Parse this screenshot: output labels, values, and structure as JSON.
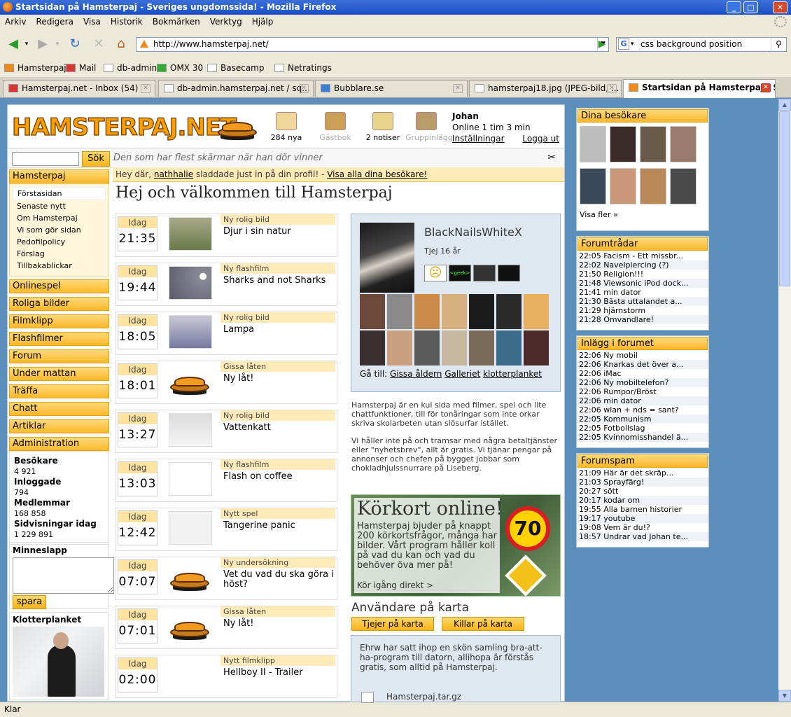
{
  "window": {
    "title": "Startsidan på Hamsterpaj - Sveriges ungdomssida! - Mozilla Firefox"
  },
  "menu": [
    "Arkiv",
    "Redigera",
    "Visa",
    "Historik",
    "Bokmärken",
    "Verktyg",
    "Hjälp"
  ],
  "nav": {
    "url": "http://www.hamsterpaj.net/",
    "search": "css background position"
  },
  "bookmarks": [
    {
      "label": "Hamsterpaj",
      "icon": "warning-triangle-icon"
    },
    {
      "label": "Mail",
      "icon": "gmail-icon"
    },
    {
      "label": "db-admin",
      "icon": "page-icon"
    },
    {
      "label": "OMX 30",
      "icon": "bar-chart-icon"
    },
    {
      "label": "Basecamp",
      "icon": "page-icon"
    },
    {
      "label": "Netratings",
      "icon": "page-icon"
    }
  ],
  "tabs": [
    {
      "label": "Hamsterpaj.net - Inbox (54)",
      "icon": "gmail-icon",
      "active": false
    },
    {
      "label": "db-admin.hamsterpaj.net / sq...",
      "icon": "page-icon",
      "active": false
    },
    {
      "label": "Bubblare.se",
      "icon": "bubble-icon",
      "active": false
    },
    {
      "label": "hamsterpaj18.jpg (JPEG-bild, ...",
      "icon": "page-icon",
      "active": false
    },
    {
      "label": "Startsidan på Hamsterpaj - S...",
      "icon": "warning-triangle-icon",
      "active": true
    }
  ],
  "status": "Klar",
  "site": {
    "logo": "HAMSTERPAJ.NET",
    "header_icons": [
      {
        "label": "284 nya",
        "icon": "envelope-icon",
        "dim": false
      },
      {
        "label": "Gästbok",
        "icon": "pencil-icon",
        "dim": true
      },
      {
        "label": "2 notiser",
        "icon": "note-icon",
        "dim": false
      },
      {
        "label": "Gruppinlägg",
        "icon": "group-icon",
        "dim": true
      }
    ],
    "user": {
      "name": "Johan",
      "online": "Online 1 tim 3 min",
      "settings": "Inställningar",
      "logout": "Logga ut"
    },
    "search": {
      "button": "Sök"
    },
    "slogan": "Den som har flest skärmar när han dör vinner",
    "notice": {
      "pre": "Hey där, ",
      "user": "nathhalie",
      "mid": " sladdade just in på din profil! - ",
      "link": "Visa alla dina besökare!"
    },
    "welcome": "Hej och välkommen till Hamsterpaj",
    "leftnav": {
      "main": "Hamsterpaj",
      "sub": [
        "Förstasidan",
        "Senaste nytt",
        "Om Hamsterpaj",
        "Vi som gör sidan",
        "Pedofilpolicy",
        "Förslag",
        "Tillbakablickar"
      ],
      "sections": [
        "Onlinespel",
        "Roliga bilder",
        "Filmklipp",
        "Flashfilmer",
        "Forum",
        "Under mattan",
        "Träffa",
        "Chatt",
        "Artiklar",
        "Administration"
      ]
    },
    "stats": [
      {
        "label": "Besökare",
        "value": "4 921"
      },
      {
        "label": "Inloggade",
        "value": "794"
      },
      {
        "label": "Medlemmar",
        "value": "168 858"
      },
      {
        "label": "Sidvisningar idag",
        "value": "1 229 891"
      }
    ],
    "memo": {
      "title": "Minneslapp",
      "button": "spara"
    },
    "klotter": {
      "title": "Klotterplanket"
    },
    "feed": [
      {
        "day": "Idag",
        "time": "21:35",
        "kind": "Ny rolig bild",
        "title": "Djur i sin natur",
        "thumb": "photo"
      },
      {
        "day": "Idag",
        "time": "19:44",
        "kind": "Ny flashfilm",
        "title": "Sharks and not Sharks",
        "thumb": "dark"
      },
      {
        "day": "Idag",
        "time": "18:05",
        "kind": "Ny rolig bild",
        "title": "Lampa",
        "thumb": "lamp"
      },
      {
        "day": "Idag",
        "time": "18:01",
        "kind": "Gissa låten",
        "title": "Ny låt!",
        "thumb": "pie"
      },
      {
        "day": "Idag",
        "time": "13:27",
        "kind": "Ny rolig bild",
        "title": "Vattenkatt",
        "thumb": "photo2"
      },
      {
        "day": "Idag",
        "time": "13:03",
        "kind": "Ny flashfilm",
        "title": "Flash on coffee",
        "thumb": "sketch"
      },
      {
        "day": "Idag",
        "time": "12:42",
        "kind": "Nytt spel",
        "title": "Tangerine panic",
        "thumb": "light"
      },
      {
        "day": "Idag",
        "time": "07:07",
        "kind": "Ny undersökning",
        "title": "Vet du vad du ska göra i höst?",
        "thumb": "pie"
      },
      {
        "day": "Idag",
        "time": "07:01",
        "kind": "Gissa låten",
        "title": "Ny låt!",
        "thumb": "pie"
      },
      {
        "day": "Idag",
        "time": "02:00",
        "kind": "Nytt filmklipp",
        "title": "Hellboy II - Trailer",
        "thumb": "none"
      }
    ],
    "profile": {
      "name": "BlackNailsWhiteX",
      "age": "Tjej 16 år",
      "goto_label": "Gå till:",
      "links": [
        "Gissa åldern",
        "Galleriet",
        "klotterplanket"
      ]
    },
    "about": [
      "Hamsterpaj är en kul sida med filmer, spel och lite chattfunktioner, till för tonåringar som inte orkar skriva skolarbeten utan slösurfar istället.",
      "Vi håller inte på och tramsar med några betaltjänster eller \"nyhetsbrev\", allt är gratis. Vi tjänar pengar på annonser och chefen på bygget jobbar som chokladhjulssnurrare på Liseberg."
    ],
    "ad": {
      "headline": "Körkort online!",
      "body": "Hamsterpaj bjuder på knappt 200 körkortsfrågor, många har bilder. Vårt program håller koll på vad du kan och vad du behöver öva mer på!",
      "cta": "Kör igång direkt >",
      "sign": "70"
    },
    "map": {
      "title": "Användare på karta",
      "girls": "Tjejer på karta",
      "boys": "Killar på karta"
    },
    "download": {
      "text": "Ehrw har satt ihop en skön samling bra-att-ha-program till datorn, allihopa är förstås gratis, som alltid på Hamsterpaj.",
      "file": "Hamsterpaj.tar.gz"
    },
    "visitors": {
      "title": "Dina besökare",
      "more": "Visa fler »"
    },
    "forum_threads": {
      "title": "Forumtrådar",
      "rows": [
        {
          "t": "22:05",
          "s": "Facism - Ett missbr..."
        },
        {
          "t": "22:02",
          "s": "Navelpiercing (?)"
        },
        {
          "t": "21:50",
          "s": "Religion!!!"
        },
        {
          "t": "21:48",
          "s": "Viewsonic iPod dock..."
        },
        {
          "t": "21:41",
          "s": "min dator"
        },
        {
          "t": "21:30",
          "s": "Bästa uttalandet a..."
        },
        {
          "t": "21:29",
          "s": "hjärnstorm"
        },
        {
          "t": "21:28",
          "s": "Omvandlare!"
        }
      ]
    },
    "forum_posts": {
      "title": "Inlägg i forumet",
      "rows": [
        {
          "t": "22:06",
          "s": "Ny mobil"
        },
        {
          "t": "22:06",
          "s": "Knarkas det över a..."
        },
        {
          "t": "22:06",
          "s": "iMac"
        },
        {
          "t": "22:06",
          "s": "Ny mobiltelefon?"
        },
        {
          "t": "22:06",
          "s": "Rumpor/Bröst"
        },
        {
          "t": "22:06",
          "s": "min dator"
        },
        {
          "t": "22:06",
          "s": "wlan + nds = sant?"
        },
        {
          "t": "22:05",
          "s": "Kommunism"
        },
        {
          "t": "22:05",
          "s": "Fotbollslag"
        },
        {
          "t": "22:05",
          "s": "Kvinnomisshandel ä..."
        }
      ]
    },
    "forum_spam": {
      "title": "Forumspam",
      "rows": [
        {
          "t": "21:09",
          "s": "Här är det skräp..."
        },
        {
          "t": "21:03",
          "s": "Sprayfärg!"
        },
        {
          "t": "20:27",
          "s": "sött"
        },
        {
          "t": "20:17",
          "s": "kodar om"
        },
        {
          "t": "19:55",
          "s": "Alla barnen historier"
        },
        {
          "t": "19:17",
          "s": "youtube"
        },
        {
          "t": "19:08",
          "s": "Vem är du!?"
        },
        {
          "t": "18:57",
          "s": "Undrar vad Johan te..."
        }
      ]
    }
  }
}
